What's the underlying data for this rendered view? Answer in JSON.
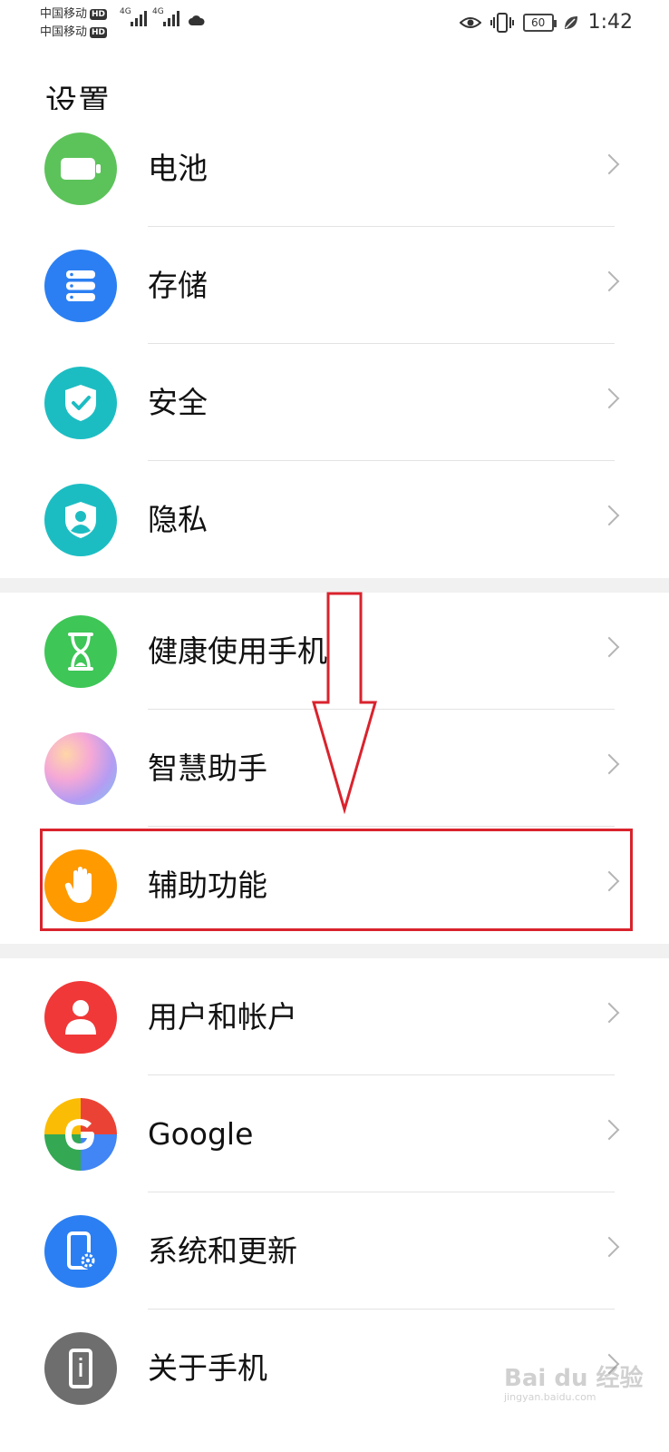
{
  "status_bar": {
    "carrier1": "中国移动",
    "carrier2": "中国移动",
    "hd": "HD",
    "net1": "4G",
    "net2": "4G",
    "battery": "60",
    "time": "1:42"
  },
  "page": {
    "title": "设置"
  },
  "groups": [
    {
      "items": [
        {
          "label": "电池",
          "icon": "battery-icon",
          "color": "#5cc35a"
        },
        {
          "label": "存储",
          "icon": "storage-icon",
          "color": "#2b7ff2"
        },
        {
          "label": "安全",
          "icon": "shield-check-icon",
          "color": "#1cbdc2"
        },
        {
          "label": "隐私",
          "icon": "privacy-icon",
          "color": "#1cbdc2"
        }
      ]
    },
    {
      "items": [
        {
          "label": "健康使用手机",
          "icon": "hourglass-icon",
          "color": "#3ec657"
        },
        {
          "label": "智慧助手",
          "icon": "assistant-icon",
          "color": "#d7a3e6"
        },
        {
          "label": "辅助功能",
          "icon": "hand-icon",
          "color": "#ff9a00"
        }
      ]
    },
    {
      "items": [
        {
          "label": "用户和帐户",
          "icon": "user-icon",
          "color": "#f03838"
        },
        {
          "label": "Google",
          "icon": "google-icon",
          "color": "#4285f4"
        },
        {
          "label": "系统和更新",
          "icon": "system-update-icon",
          "color": "#2b7ff2"
        },
        {
          "label": "关于手机",
          "icon": "phone-info-icon",
          "color": "#6e6e6e"
        }
      ]
    }
  ],
  "watermark": {
    "brand": "Bai du 经验",
    "url": "jingyan.baidu.com"
  },
  "annotation_color": "#d9232d"
}
